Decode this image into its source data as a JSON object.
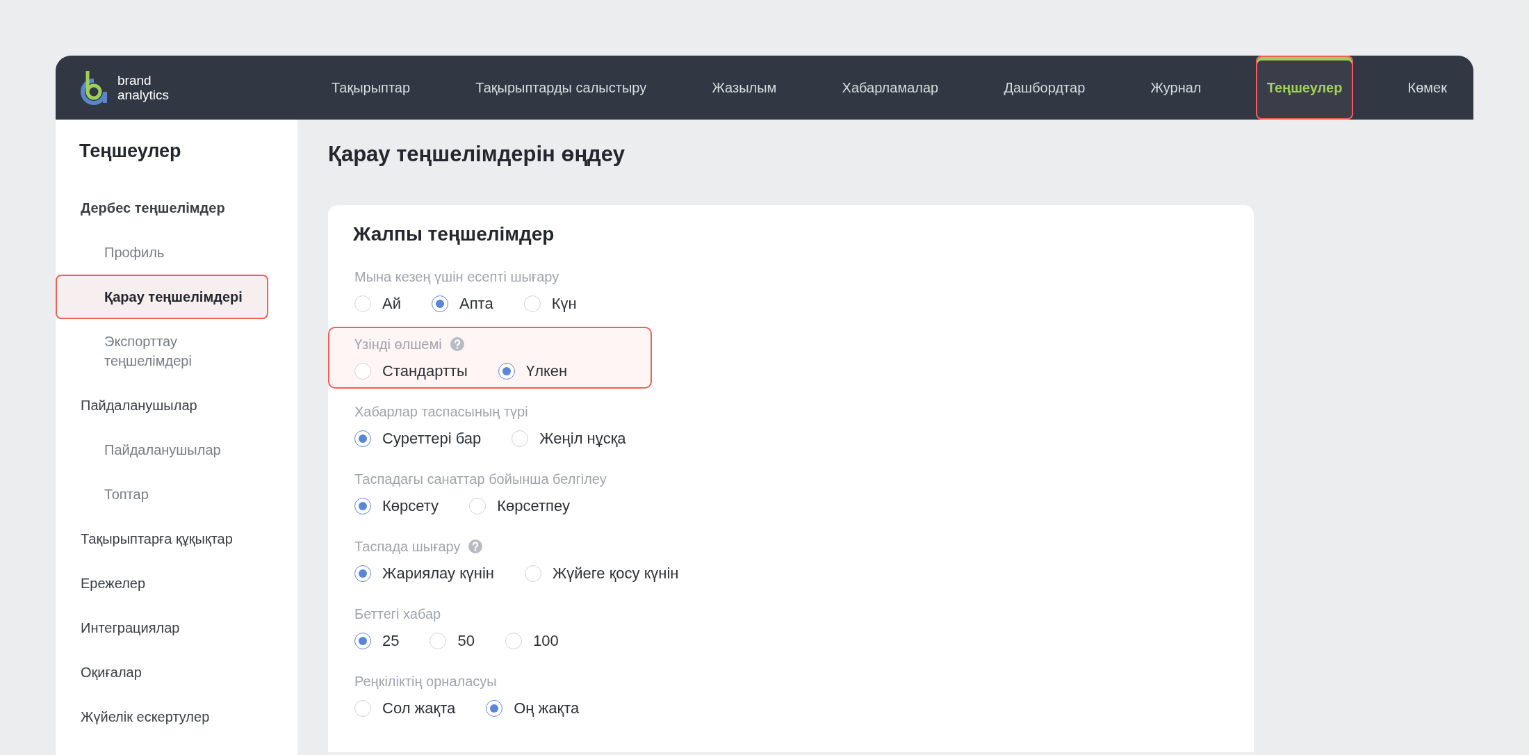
{
  "brand": {
    "lines": [
      "brand",
      "analytics"
    ]
  },
  "nav": [
    {
      "label": "Тақырыптар",
      "selected": false,
      "highlighted": false
    },
    {
      "label": "Тақырыптарды салыстыру",
      "selected": false,
      "highlighted": false
    },
    {
      "label": "Жазылым",
      "selected": false,
      "highlighted": false
    },
    {
      "label": "Хабарламалар",
      "selected": false,
      "highlighted": false
    },
    {
      "label": "Дашбордтар",
      "selected": false,
      "highlighted": false
    },
    {
      "label": "Журнал",
      "selected": false,
      "highlighted": false
    },
    {
      "label": "Теңшеулер",
      "selected": true,
      "highlighted": true
    },
    {
      "label": "Көмек",
      "selected": false,
      "highlighted": false
    }
  ],
  "sidebar": {
    "title": "Теңшеулер",
    "items": [
      {
        "label": "Дербес теңшелімдер",
        "selected": false,
        "highlighted": false,
        "children": [
          {
            "label": "Профиль",
            "selected": false,
            "highlighted": false
          },
          {
            "label": "Қарау теңшелімдері",
            "selected": true,
            "highlighted": true
          },
          {
            "label": "Экспорттау теңшелімдері",
            "selected": false,
            "highlighted": false
          }
        ]
      },
      {
        "label": "Пайдаланушылар",
        "selected": false,
        "highlighted": false,
        "children": [
          {
            "label": "Пайдаланушылар",
            "selected": false,
            "highlighted": false
          },
          {
            "label": "Топтар",
            "selected": false,
            "highlighted": false
          }
        ]
      },
      {
        "label": "Тақырыптарға құқықтар",
        "selected": false,
        "highlighted": false
      },
      {
        "label": "Ережелер",
        "selected": false,
        "highlighted": false
      },
      {
        "label": "Интеграциялар",
        "selected": false,
        "highlighted": false
      },
      {
        "label": "Оқиғалар",
        "selected": false,
        "highlighted": false
      },
      {
        "label": "Жүйелік ескертулер",
        "selected": false,
        "highlighted": false
      }
    ]
  },
  "page_title": "Қарау теңшелімдерін өңдеу",
  "card": {
    "title": "Жалпы теңшелімдер",
    "fields": [
      {
        "label": "Мына кезең үшін есепті шығару",
        "help": false,
        "highlighted": false,
        "options": [
          {
            "label": "Ай",
            "selected": false
          },
          {
            "label": "Апта",
            "selected": true
          },
          {
            "label": "Күн",
            "selected": false
          }
        ]
      },
      {
        "label": "Үзінді өлшемі",
        "help": true,
        "highlighted": true,
        "options": [
          {
            "label": "Стандартты",
            "selected": false
          },
          {
            "label": "Үлкен",
            "selected": true
          }
        ]
      },
      {
        "label": "Хабарлар таспасының түрі",
        "help": false,
        "highlighted": false,
        "options": [
          {
            "label": "Суреттері бар",
            "selected": true
          },
          {
            "label": "Жеңіл нұсқа",
            "selected": false
          }
        ]
      },
      {
        "label": "Таспадағы санаттар бойынша белгілеу",
        "help": false,
        "highlighted": false,
        "options": [
          {
            "label": "Көрсету",
            "selected": true
          },
          {
            "label": "Көрсетпеу",
            "selected": false
          }
        ]
      },
      {
        "label": "Таспада шығару",
        "help": true,
        "highlighted": false,
        "options": [
          {
            "label": "Жариялау күнін",
            "selected": true
          },
          {
            "label": "Жүйеге қосу күнін",
            "selected": false
          }
        ]
      },
      {
        "label": "Беттегі хабар",
        "help": false,
        "highlighted": false,
        "options": [
          {
            "label": "25",
            "selected": true
          },
          {
            "label": "50",
            "selected": false
          },
          {
            "label": "100",
            "selected": false
          }
        ]
      },
      {
        "label": "Реңкіліктің орналасуы",
        "help": false,
        "highlighted": false,
        "options": [
          {
            "label": "Сол жақта",
            "selected": false
          },
          {
            "label": "Оң жақта",
            "selected": true
          }
        ]
      }
    ]
  }
}
